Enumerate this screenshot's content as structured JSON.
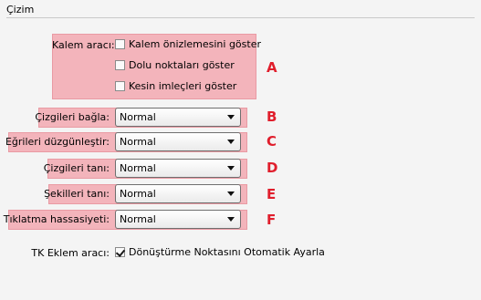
{
  "section": {
    "title": "Çizim"
  },
  "pen_tool": {
    "label": "Kalem aracı:",
    "options": [
      {
        "label": "Kalem önizlemesini göster",
        "checked": false
      },
      {
        "label": "Dolu noktaları göster",
        "checked": false
      },
      {
        "label": "Kesin imleçleri göster",
        "checked": false
      }
    ],
    "marker": "A"
  },
  "settings": [
    {
      "label": "Çizgileri bağla:",
      "value": "Normal",
      "marker": "B"
    },
    {
      "label": "Eğrileri düzgünleştir:",
      "value": "Normal",
      "marker": "C"
    },
    {
      "label": "Çizgileri tanı:",
      "value": "Normal",
      "marker": "D"
    },
    {
      "label": "Şekilleri tanı:",
      "value": "Normal",
      "marker": "E"
    },
    {
      "label": "Tıklatma hassasiyeti:",
      "value": "Normal",
      "marker": "F"
    }
  ],
  "tk_tool": {
    "label": "TK Eklem aracı:",
    "option": {
      "label": "Dönüştürme Noktasını Otomatik Ayarla",
      "checked": true
    }
  },
  "colors": {
    "highlight": "#f3b4bb",
    "marker": "#e01e2c"
  }
}
